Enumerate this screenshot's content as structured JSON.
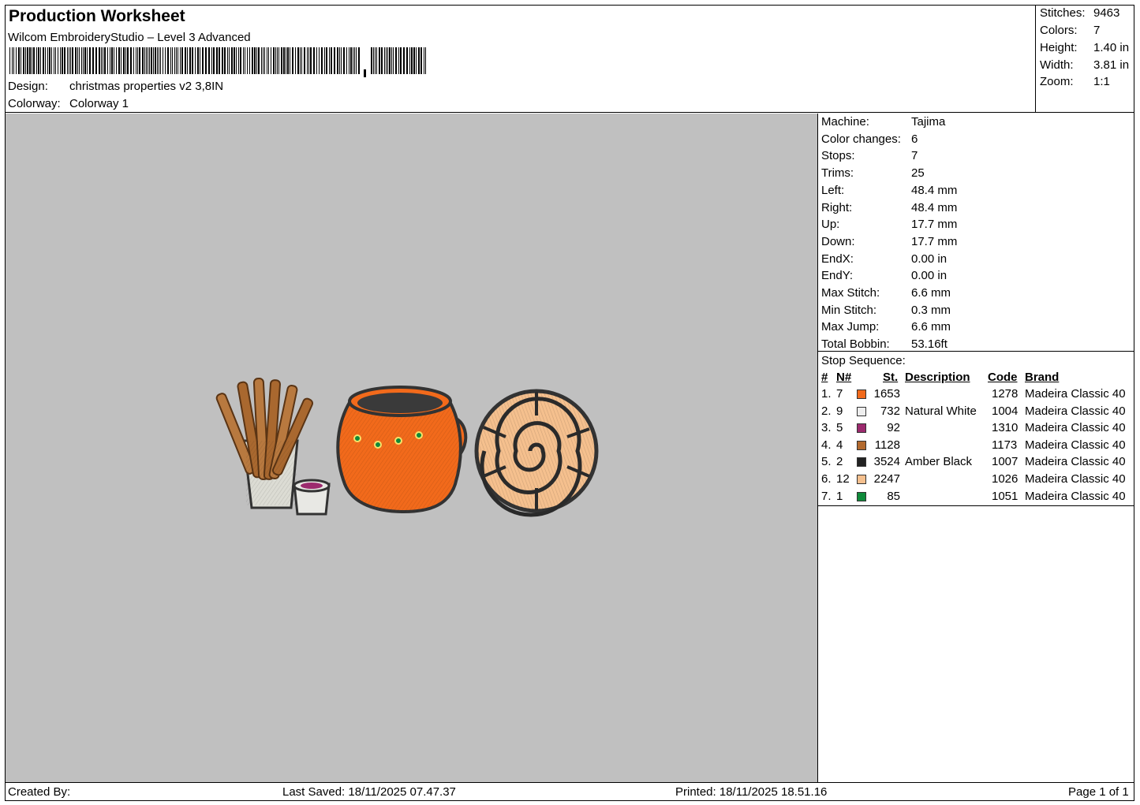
{
  "header": {
    "title": "Production Worksheet",
    "subtitle": "Wilcom EmbroideryStudio – Level 3 Advanced",
    "design_label": "Design:",
    "design_value": "christmas properties v2 3,8IN",
    "colorway_label": "Colorway:",
    "colorway_value": "Colorway 1"
  },
  "summary": {
    "stitches_label": "Stitches:",
    "stitches_value": "9463",
    "colors_label": "Colors:",
    "colors_value": "7",
    "height_label": "Height:",
    "height_value": "1.40 in",
    "width_label": "Width:",
    "width_value": "3.81 in",
    "zoom_label": "Zoom:",
    "zoom_value": "1:1"
  },
  "info": [
    {
      "k": "Machine:",
      "v": "Tajima"
    },
    {
      "k": "Color changes:",
      "v": "6"
    },
    {
      "k": "Stops:",
      "v": "7"
    },
    {
      "k": "Trims:",
      "v": "25"
    },
    {
      "k": "Left:",
      "v": "48.4 mm"
    },
    {
      "k": "Right:",
      "v": "48.4 mm"
    },
    {
      "k": "Up:",
      "v": "17.7 mm"
    },
    {
      "k": "Down:",
      "v": "17.7 mm"
    },
    {
      "k": "EndX:",
      "v": "0.00 in"
    },
    {
      "k": "EndY:",
      "v": "0.00 in"
    },
    {
      "k": "Max Stitch:",
      "v": "6.6 mm"
    },
    {
      "k": "Min Stitch:",
      "v": "0.3 mm"
    },
    {
      "k": "Max Jump:",
      "v": "6.6 mm"
    },
    {
      "k": "Total Bobbin:",
      "v": "53.16ft"
    }
  ],
  "stop_sequence": {
    "caption": "Stop Sequence:",
    "headers": {
      "num": "#",
      "n": "N#",
      "st": "St.",
      "desc": "Description",
      "code": "Code",
      "brand": "Brand"
    },
    "rows": [
      {
        "num": "1.",
        "n": "7",
        "color": "#f26a1b",
        "st": "1653",
        "desc": "",
        "code": "1278",
        "brand": "Madeira Classic 40"
      },
      {
        "num": "2.",
        "n": "9",
        "color": "#eeeeee",
        "st": "732",
        "desc": "Natural White",
        "code": "1004",
        "brand": "Madeira Classic 40"
      },
      {
        "num": "3.",
        "n": "5",
        "color": "#9c2a6e",
        "st": "92",
        "desc": "",
        "code": "1310",
        "brand": "Madeira Classic 40"
      },
      {
        "num": "4.",
        "n": "4",
        "color": "#b36a2e",
        "st": "1128",
        "desc": "",
        "code": "1173",
        "brand": "Madeira Classic 40"
      },
      {
        "num": "5.",
        "n": "2",
        "color": "#222222",
        "st": "3524",
        "desc": "Amber Black",
        "code": "1007",
        "brand": "Madeira Classic 40"
      },
      {
        "num": "6.",
        "n": "12",
        "color": "#f5c08e",
        "st": "2247",
        "desc": "",
        "code": "1026",
        "brand": "Madeira Classic 40"
      },
      {
        "num": "7.",
        "n": "1",
        "color": "#0f8a3a",
        "st": "85",
        "desc": "",
        "code": "1051",
        "brand": "Madeira Classic 40"
      }
    ]
  },
  "footer": {
    "created_by": "Created By:",
    "last_saved": "Last Saved: 18/11/2025 07.47.37",
    "printed": "Printed: 18/11/2025 18.51.16",
    "page": "Page 1 of 1"
  }
}
